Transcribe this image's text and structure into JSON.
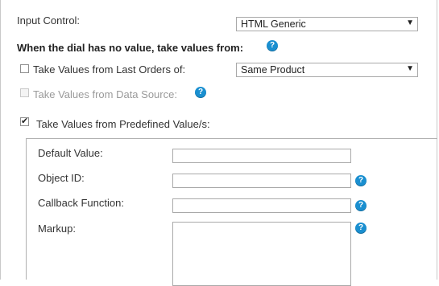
{
  "input_control": {
    "label": "Input Control:",
    "selected": "HTML Generic"
  },
  "no_value_heading": {
    "text": "When the dial has no value, take values from:"
  },
  "last_orders": {
    "label": "Take Values from Last Orders of:",
    "checked": false,
    "selected": "Same Product"
  },
  "data_source": {
    "label": "Take Values from Data Source:",
    "checked": false,
    "disabled": true
  },
  "predefined": {
    "label": "Take Values from Predefined Value/s:",
    "checked": true
  },
  "fields": {
    "default_value": {
      "label": "Default Value:",
      "value": ""
    },
    "object_id": {
      "label": "Object ID:",
      "value": ""
    },
    "callback_function": {
      "label": "Callback Function:",
      "value": ""
    },
    "markup": {
      "label": "Markup:",
      "value": ""
    }
  },
  "icons": {
    "dropdown": "chevron-down-icon",
    "help": "help-icon",
    "checkbox_checked": "check-icon"
  },
  "colors": {
    "help_icon": "#1a8fd0",
    "border": "#a9a9a9",
    "disabled_text": "#9a9a9a"
  }
}
